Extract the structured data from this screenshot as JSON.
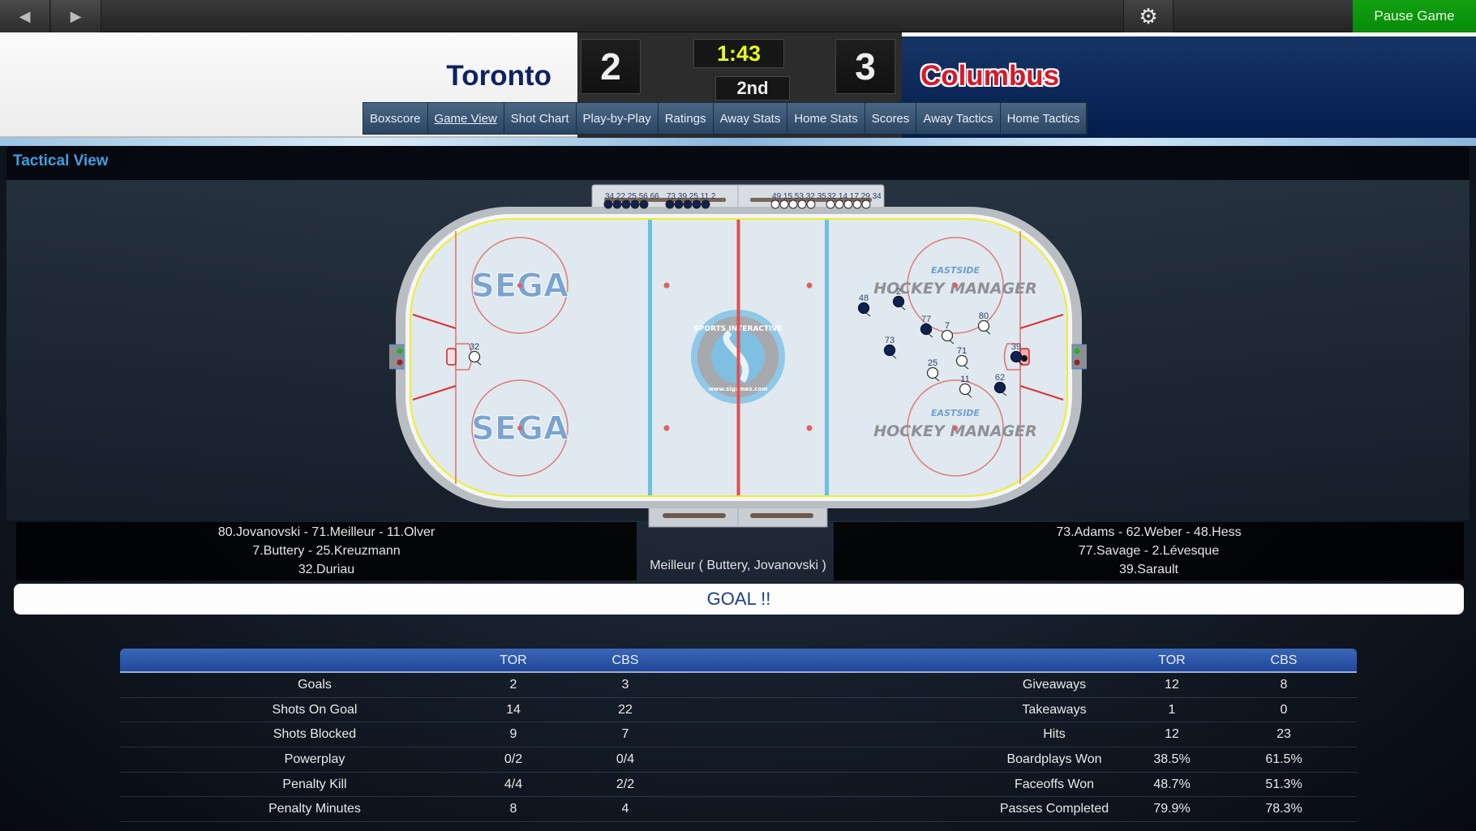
{
  "topbar": {
    "back_icon": "chevron-left-icon",
    "forward_icon": "chevron-right-icon",
    "settings_icon": "gear-icon",
    "pause_label": "Pause Game"
  },
  "header": {
    "away_team": "Toronto",
    "home_team": "Columbus",
    "away_score": "2",
    "home_score": "3",
    "clock": "1:43",
    "period": "2nd",
    "colors": {
      "away": "#0e2263",
      "home": "#d7192a",
      "clock": "#e9ff1d"
    }
  },
  "tabs": [
    {
      "label": "Boxscore",
      "active": false
    },
    {
      "label": "Game View",
      "active": true
    },
    {
      "label": "Shot Chart",
      "active": false
    },
    {
      "label": "Play-by-Play",
      "active": false
    },
    {
      "label": "Ratings",
      "active": false
    },
    {
      "label": "Away Stats",
      "active": false
    },
    {
      "label": "Home Stats",
      "active": false
    },
    {
      "label": "Scores",
      "active": false
    },
    {
      "label": "Away Tactics",
      "active": false
    },
    {
      "label": "Home Tactics",
      "active": false
    }
  ],
  "tactical": {
    "title": "Tactical View",
    "rink_logos": {
      "left_zone": "SEGA",
      "center": "SPORTS INTERACTIVE www.sigames.com",
      "right_zone_top": "EASTSIDE",
      "right_zone_bottom": "HOCKEY MANAGER"
    },
    "away_bench_left": "34 22 25 56 66",
    "away_bench_right": "73 39 25 11 2",
    "home_bench_left": "49 15 53 32 35",
    "home_bench_right": "32 14 17 29 34",
    "away_players_on_ice": [
      "80",
      "7",
      "71",
      "25",
      "11",
      "32"
    ],
    "home_players_on_ice": [
      "48",
      "2",
      "77",
      "73",
      "62",
      "39"
    ],
    "away_lineup": [
      "80.Jovanovski - 71.Meilleur - 11.Olver",
      "7.Buttery - 25.Kreuzmann",
      "32.Duriau"
    ],
    "home_lineup": [
      "73.Adams - 62.Weber - 48.Hess",
      "77.Savage - 2.Lévesque",
      "39.Sarault"
    ],
    "scorer": "Meilleur ( Buttery, Jovanovski )",
    "event": "GOAL !!"
  },
  "stats": {
    "headers": {
      "away": "TOR",
      "home": "CBS"
    },
    "left": [
      {
        "label": "Goals",
        "tor": "2",
        "cbs": "3"
      },
      {
        "label": "Shots On Goal",
        "tor": "14",
        "cbs": "22"
      },
      {
        "label": "Shots Blocked",
        "tor": "9",
        "cbs": "7"
      },
      {
        "label": "Powerplay",
        "tor": "0/2",
        "cbs": "0/4"
      },
      {
        "label": "Penalty Kill",
        "tor": "4/4",
        "cbs": "2/2"
      },
      {
        "label": "Penalty Minutes",
        "tor": "8",
        "cbs": "4"
      }
    ],
    "right": [
      {
        "label": "Giveaways",
        "tor": "12",
        "cbs": "8"
      },
      {
        "label": "Takeaways",
        "tor": "1",
        "cbs": "0"
      },
      {
        "label": "Hits",
        "tor": "12",
        "cbs": "23"
      },
      {
        "label": "Boardplays Won",
        "tor": "38.5%",
        "cbs": "61.5%"
      },
      {
        "label": "Faceoffs Won",
        "tor": "48.7%",
        "cbs": "51.3%"
      },
      {
        "label": "Passes Completed",
        "tor": "79.9%",
        "cbs": "78.3%"
      }
    ]
  }
}
